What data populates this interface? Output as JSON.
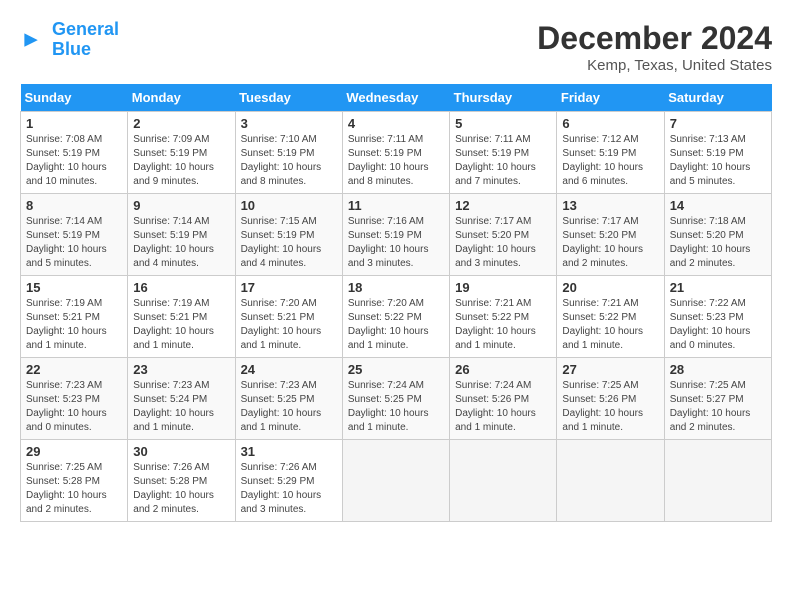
{
  "logo": {
    "text_general": "General",
    "text_blue": "Blue"
  },
  "header": {
    "month": "December 2024",
    "location": "Kemp, Texas, United States"
  },
  "days_of_week": [
    "Sunday",
    "Monday",
    "Tuesday",
    "Wednesday",
    "Thursday",
    "Friday",
    "Saturday"
  ],
  "weeks": [
    [
      {
        "day": "1",
        "sunrise": "Sunrise: 7:08 AM",
        "sunset": "Sunset: 5:19 PM",
        "daylight": "Daylight: 10 hours and 10 minutes."
      },
      {
        "day": "2",
        "sunrise": "Sunrise: 7:09 AM",
        "sunset": "Sunset: 5:19 PM",
        "daylight": "Daylight: 10 hours and 9 minutes."
      },
      {
        "day": "3",
        "sunrise": "Sunrise: 7:10 AM",
        "sunset": "Sunset: 5:19 PM",
        "daylight": "Daylight: 10 hours and 8 minutes."
      },
      {
        "day": "4",
        "sunrise": "Sunrise: 7:11 AM",
        "sunset": "Sunset: 5:19 PM",
        "daylight": "Daylight: 10 hours and 8 minutes."
      },
      {
        "day": "5",
        "sunrise": "Sunrise: 7:11 AM",
        "sunset": "Sunset: 5:19 PM",
        "daylight": "Daylight: 10 hours and 7 minutes."
      },
      {
        "day": "6",
        "sunrise": "Sunrise: 7:12 AM",
        "sunset": "Sunset: 5:19 PM",
        "daylight": "Daylight: 10 hours and 6 minutes."
      },
      {
        "day": "7",
        "sunrise": "Sunrise: 7:13 AM",
        "sunset": "Sunset: 5:19 PM",
        "daylight": "Daylight: 10 hours and 5 minutes."
      }
    ],
    [
      {
        "day": "8",
        "sunrise": "Sunrise: 7:14 AM",
        "sunset": "Sunset: 5:19 PM",
        "daylight": "Daylight: 10 hours and 5 minutes."
      },
      {
        "day": "9",
        "sunrise": "Sunrise: 7:14 AM",
        "sunset": "Sunset: 5:19 PM",
        "daylight": "Daylight: 10 hours and 4 minutes."
      },
      {
        "day": "10",
        "sunrise": "Sunrise: 7:15 AM",
        "sunset": "Sunset: 5:19 PM",
        "daylight": "Daylight: 10 hours and 4 minutes."
      },
      {
        "day": "11",
        "sunrise": "Sunrise: 7:16 AM",
        "sunset": "Sunset: 5:19 PM",
        "daylight": "Daylight: 10 hours and 3 minutes."
      },
      {
        "day": "12",
        "sunrise": "Sunrise: 7:17 AM",
        "sunset": "Sunset: 5:20 PM",
        "daylight": "Daylight: 10 hours and 3 minutes."
      },
      {
        "day": "13",
        "sunrise": "Sunrise: 7:17 AM",
        "sunset": "Sunset: 5:20 PM",
        "daylight": "Daylight: 10 hours and 2 minutes."
      },
      {
        "day": "14",
        "sunrise": "Sunrise: 7:18 AM",
        "sunset": "Sunset: 5:20 PM",
        "daylight": "Daylight: 10 hours and 2 minutes."
      }
    ],
    [
      {
        "day": "15",
        "sunrise": "Sunrise: 7:19 AM",
        "sunset": "Sunset: 5:21 PM",
        "daylight": "Daylight: 10 hours and 1 minute."
      },
      {
        "day": "16",
        "sunrise": "Sunrise: 7:19 AM",
        "sunset": "Sunset: 5:21 PM",
        "daylight": "Daylight: 10 hours and 1 minute."
      },
      {
        "day": "17",
        "sunrise": "Sunrise: 7:20 AM",
        "sunset": "Sunset: 5:21 PM",
        "daylight": "Daylight: 10 hours and 1 minute."
      },
      {
        "day": "18",
        "sunrise": "Sunrise: 7:20 AM",
        "sunset": "Sunset: 5:22 PM",
        "daylight": "Daylight: 10 hours and 1 minute."
      },
      {
        "day": "19",
        "sunrise": "Sunrise: 7:21 AM",
        "sunset": "Sunset: 5:22 PM",
        "daylight": "Daylight: 10 hours and 1 minute."
      },
      {
        "day": "20",
        "sunrise": "Sunrise: 7:21 AM",
        "sunset": "Sunset: 5:22 PM",
        "daylight": "Daylight: 10 hours and 1 minute."
      },
      {
        "day": "21",
        "sunrise": "Sunrise: 7:22 AM",
        "sunset": "Sunset: 5:23 PM",
        "daylight": "Daylight: 10 hours and 0 minutes."
      }
    ],
    [
      {
        "day": "22",
        "sunrise": "Sunrise: 7:23 AM",
        "sunset": "Sunset: 5:23 PM",
        "daylight": "Daylight: 10 hours and 0 minutes."
      },
      {
        "day": "23",
        "sunrise": "Sunrise: 7:23 AM",
        "sunset": "Sunset: 5:24 PM",
        "daylight": "Daylight: 10 hours and 1 minute."
      },
      {
        "day": "24",
        "sunrise": "Sunrise: 7:23 AM",
        "sunset": "Sunset: 5:25 PM",
        "daylight": "Daylight: 10 hours and 1 minute."
      },
      {
        "day": "25",
        "sunrise": "Sunrise: 7:24 AM",
        "sunset": "Sunset: 5:25 PM",
        "daylight": "Daylight: 10 hours and 1 minute."
      },
      {
        "day": "26",
        "sunrise": "Sunrise: 7:24 AM",
        "sunset": "Sunset: 5:26 PM",
        "daylight": "Daylight: 10 hours and 1 minute."
      },
      {
        "day": "27",
        "sunrise": "Sunrise: 7:25 AM",
        "sunset": "Sunset: 5:26 PM",
        "daylight": "Daylight: 10 hours and 1 minute."
      },
      {
        "day": "28",
        "sunrise": "Sunrise: 7:25 AM",
        "sunset": "Sunset: 5:27 PM",
        "daylight": "Daylight: 10 hours and 2 minutes."
      }
    ],
    [
      {
        "day": "29",
        "sunrise": "Sunrise: 7:25 AM",
        "sunset": "Sunset: 5:28 PM",
        "daylight": "Daylight: 10 hours and 2 minutes."
      },
      {
        "day": "30",
        "sunrise": "Sunrise: 7:26 AM",
        "sunset": "Sunset: 5:28 PM",
        "daylight": "Daylight: 10 hours and 2 minutes."
      },
      {
        "day": "31",
        "sunrise": "Sunrise: 7:26 AM",
        "sunset": "Sunset: 5:29 PM",
        "daylight": "Daylight: 10 hours and 3 minutes."
      },
      null,
      null,
      null,
      null
    ]
  ]
}
